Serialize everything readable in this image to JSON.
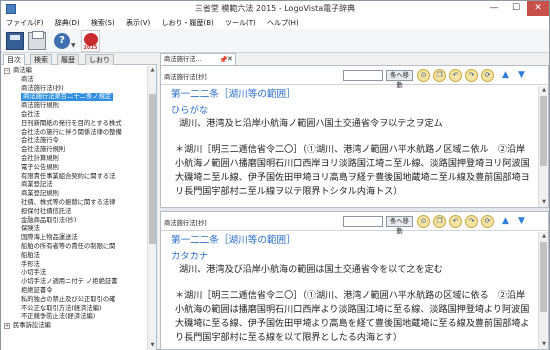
{
  "window": {
    "title": "三省堂 模範六法 2015 - LogoVista電子辞典",
    "minimize": "—",
    "maximize": "☐",
    "close": "✕"
  },
  "menu": {
    "items": [
      "ファイル(F)",
      "辞典(D)",
      "検索(S)",
      "表示(V)",
      "しおり・履歴(B)",
      "ツール(T)",
      "ヘルプ(H)"
    ]
  },
  "toolbar": {
    "help_glyph": "?",
    "dropdown_glyph": "▼",
    "sanseido_badge": "2015"
  },
  "left_panel": {
    "tabs": [
      "目次",
      "検索",
      "履歴",
      "しおり"
    ],
    "tree": [
      {
        "label": "商法編",
        "toggle": "−",
        "level": 1
      },
      {
        "label": "商法",
        "level": 2
      },
      {
        "label": "商法施行法(抄)",
        "level": 2
      },
      {
        "label": "商法施行法第百二十二条ノ規定",
        "level": 2,
        "selected": true
      },
      {
        "label": "商法施行規則",
        "level": 2
      },
      {
        "label": "会社法",
        "level": 2
      },
      {
        "label": "日刊新聞紙の発行を目的とする株式",
        "level": 2
      },
      {
        "label": "会社法の施行に伴う関係法律の整備",
        "level": 2
      },
      {
        "label": "会社法施行令",
        "level": 2
      },
      {
        "label": "会社法施行規則",
        "level": 2
      },
      {
        "label": "会社計算規則",
        "level": 2
      },
      {
        "label": "電子公告規則",
        "level": 2
      },
      {
        "label": "有限責任事業組合契約に関する法",
        "level": 2
      },
      {
        "label": "商業登記法",
        "level": 2
      },
      {
        "label": "商業登記規則",
        "level": 2
      },
      {
        "label": "社債、株式等の振替に関する法律",
        "level": 2
      },
      {
        "label": "担保付社債信託法",
        "level": 2
      },
      {
        "label": "金融商品取引法(抄)",
        "level": 2
      },
      {
        "label": "保険法",
        "level": 2
      },
      {
        "label": "国際海上物品運送法",
        "level": 2
      },
      {
        "label": "船舶の所有者等の責任の制限に関",
        "level": 2
      },
      {
        "label": "船舶法",
        "level": 2
      },
      {
        "label": "手形法",
        "level": 2
      },
      {
        "label": "小切手法",
        "level": 2
      },
      {
        "label": "小切手法ノ適用ニ付テ ノ拒絶証書",
        "level": 2
      },
      {
        "label": "拒絶証書令",
        "level": 2
      },
      {
        "label": "私的独占の禁止及び公正取引の確",
        "level": 2
      },
      {
        "label": "不公正な取引方法(経済法編)",
        "level": 2
      },
      {
        "label": "不正競争防止法(経済法編)",
        "level": 2
      },
      {
        "label": "民事訴訟法編",
        "toggle": "+",
        "level": 1
      }
    ]
  },
  "right_tab": {
    "label": "商法施行法…",
    "pin": "📌",
    "close": "✕"
  },
  "panes": [
    {
      "label": "商法施行法[抄]",
      "search_value": "",
      "jump_label": "条へ移動",
      "article": "第一二二条［湖川等の範囲］",
      "reading_label": "ひらがな",
      "body": "湖川、港湾及ヒ沿岸小航海ノ範囲ハ国土交通省令ヲ以テ之ヲ定ム",
      "note": "＊湖川［明三二逓信省令二〇］（①湖川、港湾ノ範囲ハ平水航路ノ区域ニ依ル　②沿岸小航海ノ範囲ハ播磨国明石川口西岸ヨリ淡路国江埼ニ至ル線、淡路国押登埼ヨリ阿波国大磯埼ニ至ル線、伊予国佐田甲埼ヨリ高島ヲ経テ豊後国地蔵埼ニ至ル線及豊前国部埼ヨリ長門国宇部村ニ至ル線ヲ以テ限界トシタル内海トス）"
    },
    {
      "label": "商法施行法[抄]",
      "search_value": "",
      "jump_label": "条へ移動",
      "article": "第一二二条［湖川等の範囲］",
      "reading_label": "カタカナ",
      "body": "湖川、港湾及び沿岸小航海の範囲は国土交通省令を以て之を定む",
      "note": "＊湖川［明三二逓信省令二〇］（①湖川、港湾ノ範囲ハ平水航路の区域に依る　②沿岸小航海の範囲は播磨国明石川口西岸より淡路国江埼に至る線、淡路国押登埼より阿波国大磯埼に至る線、伊予国佐田甲埼より高島を経て豊後国地蔵埼に至る線及豊前国部埼より長門国宇部村に至る線を以て限界としたる内海とす）"
    }
  ],
  "pane_buttons": [
    "magnifier",
    "copy",
    "back",
    "forward",
    "refresh",
    "up",
    "down"
  ],
  "colors": {
    "accent_blue": "#2b6fc9",
    "selection": "#3390e0",
    "close_red": "#c7504a"
  }
}
